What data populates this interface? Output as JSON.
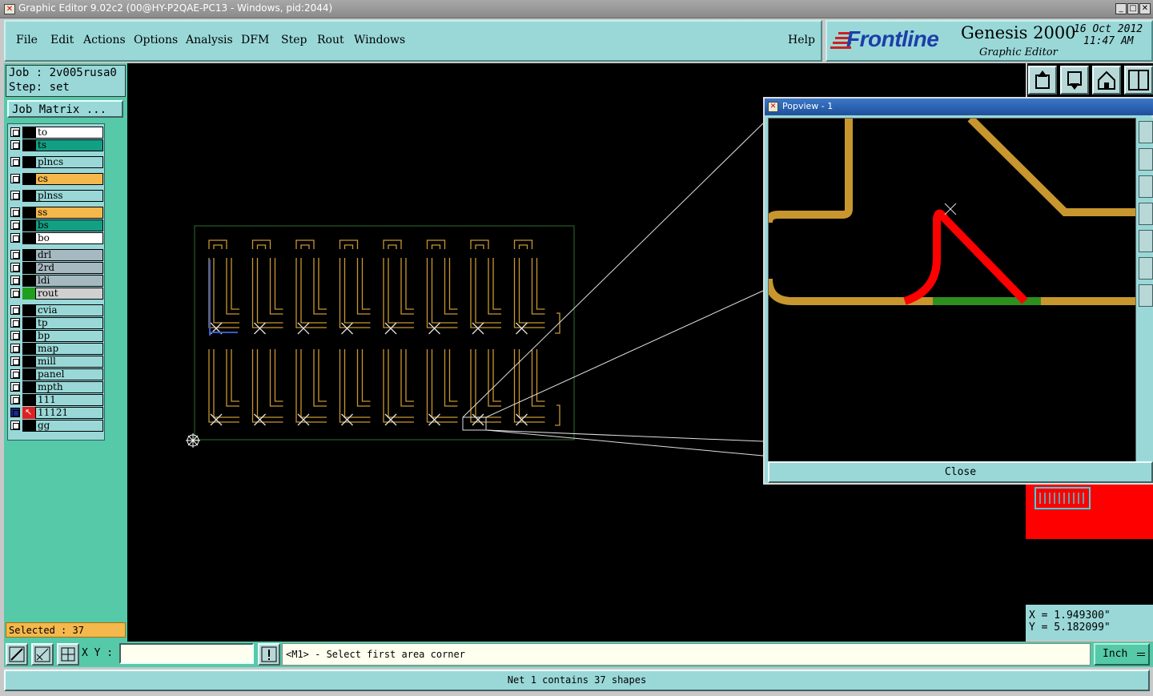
{
  "window": {
    "title": "Graphic Editor 9.02c2 (00@HY-P2QAE-PC13 - Windows, pid:2044)"
  },
  "menubar": {
    "items": [
      {
        "label": "File"
      },
      {
        "label": "Edit"
      },
      {
        "label": "Actions"
      },
      {
        "label": "Options"
      },
      {
        "label": "Analysis"
      },
      {
        "label": "DFM"
      },
      {
        "label": "Step"
      },
      {
        "label": "Rout"
      },
      {
        "label": "Windows"
      }
    ],
    "help": "Help"
  },
  "brand": {
    "logo": "Frontline",
    "product": "Genesis 2000",
    "subtitle": "Graphic Editor",
    "date": "16 Oct 2012",
    "time": "11:47 AM"
  },
  "job": {
    "job_label": "Job : 2v005rusa0",
    "step_label": "Step: set",
    "matrix_button": "Job Matrix ..."
  },
  "layers": [
    {
      "name": "to",
      "color": "#ffffff"
    },
    {
      "name": "ts",
      "color": "#139f84"
    },
    {
      "name": "plncs",
      "color": "#9ad8d8"
    },
    {
      "name": "cs",
      "color": "#f5b84c"
    },
    {
      "name": "plnss",
      "color": "#9ad8d8"
    },
    {
      "name": "ss",
      "color": "#f5b84c"
    },
    {
      "name": "bs",
      "color": "#139f84"
    },
    {
      "name": "bo",
      "color": "#ffffff"
    },
    {
      "name": "drl",
      "color": "#a6b8c0"
    },
    {
      "name": "2rd",
      "color": "#a6b8c0"
    },
    {
      "name": "ldi",
      "color": "#a6b8c0"
    },
    {
      "name": "rout",
      "color": "#d0d0d0"
    },
    {
      "name": "cvia",
      "color": "#9ad8d8"
    },
    {
      "name": "tp",
      "color": "#9ad8d8"
    },
    {
      "name": "bp",
      "color": "#9ad8d8"
    },
    {
      "name": "map",
      "color": "#9ad8d8"
    },
    {
      "name": "mill",
      "color": "#9ad8d8"
    },
    {
      "name": "panel",
      "color": "#9ad8d8"
    },
    {
      "name": "mpth",
      "color": "#9ad8d8"
    },
    {
      "name": "111",
      "color": "#9ad8d8"
    },
    {
      "name": "11121",
      "color": "#9ad8d8"
    },
    {
      "name": "gg",
      "color": "#9ad8d8"
    }
  ],
  "selected_label": "Selected : 37",
  "popview": {
    "title": "Popview - 1",
    "close_label": "Close"
  },
  "coords": {
    "x": "X = 1.949300\"",
    "y": "Y = 5.182099\""
  },
  "bottom": {
    "xy_label": "X Y :",
    "xy_value": "",
    "prompt": "<M1> - Select first area corner",
    "unit": "Inch"
  },
  "status": "Net 1 contains 37 shapes"
}
